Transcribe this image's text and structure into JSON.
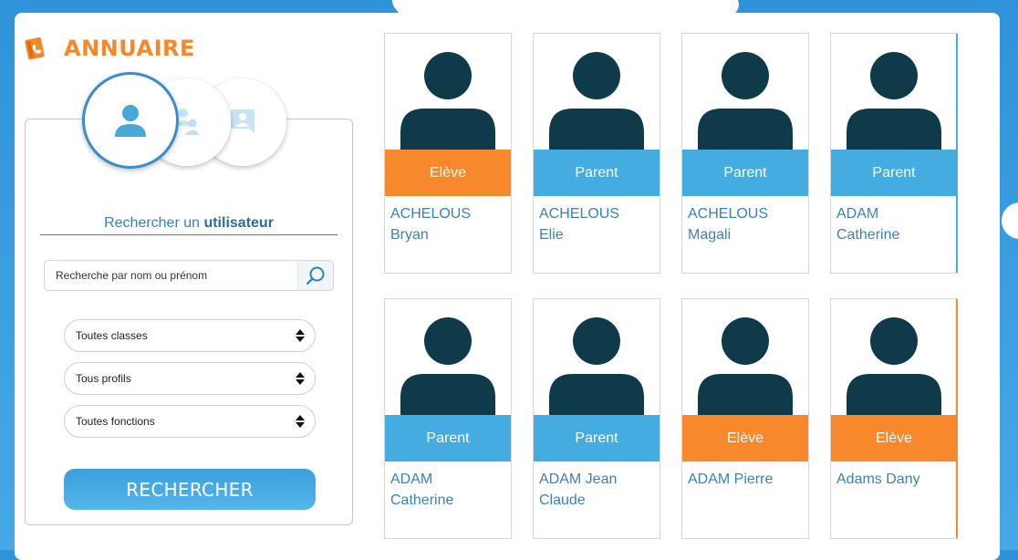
{
  "header": {
    "title": "ANNUAIRE",
    "title_color": "#f5882b",
    "icon": "directory-book-icon"
  },
  "search": {
    "modes": [
      {
        "name": "single-user",
        "icon": "user-icon",
        "active": true
      },
      {
        "name": "group-users",
        "icon": "users-group-icon",
        "active": false
      },
      {
        "name": "contact-card",
        "icon": "contact-card-icon",
        "active": false
      }
    ],
    "heading_prefix": "Rechercher un ",
    "heading_bold": "utilisateur",
    "placeholder": "Recherche par nom ou prénom",
    "search_icon": "magnifier-icon",
    "filters": {
      "classes": "Toutes classes",
      "profils": "Tous profils",
      "fonctions": "Toutes fonctions"
    },
    "submit_label": "RECHERCHER"
  },
  "colors": {
    "eleve": "#f7892c",
    "parent": "#45ace2",
    "avatar": "#0f3a4a",
    "name_text": "#3a80bf"
  },
  "users": [
    {
      "role": "Elève",
      "type": "eleve",
      "line1": "ACHELOUS",
      "line2": "Bryan"
    },
    {
      "role": "Parent",
      "type": "parent",
      "line1": "ACHELOUS",
      "line2": "Elie"
    },
    {
      "role": "Parent",
      "type": "parent",
      "line1": "ACHELOUS",
      "line2": "Magali"
    },
    {
      "role": "Parent",
      "type": "parent",
      "line1": "ADAM",
      "line2": "Catherine"
    },
    {
      "role": "Parent",
      "type": "parent",
      "line1": "ADAM",
      "line2": "Catherine"
    },
    {
      "role": "Parent",
      "type": "parent",
      "line1": "ADAM Jean",
      "line2": "Claude"
    },
    {
      "role": "Elève",
      "type": "eleve",
      "line1": "ADAM Pierre",
      "line2": ""
    },
    {
      "role": "Elève",
      "type": "eleve",
      "line1": "Adams Dany",
      "line2": ""
    }
  ]
}
